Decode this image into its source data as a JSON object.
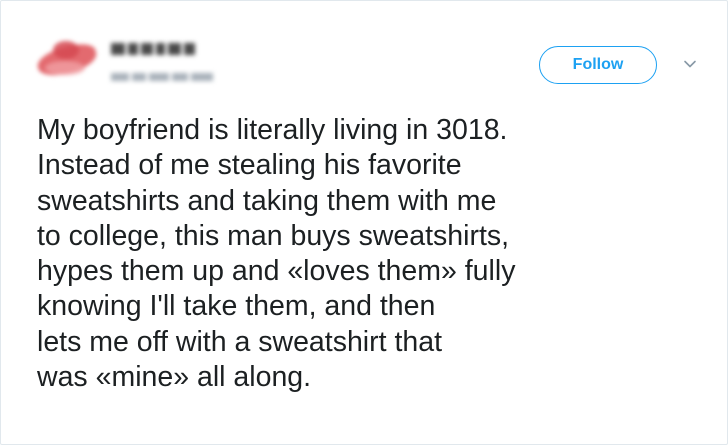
{
  "header": {
    "follow_label": "Follow",
    "accent_color": "#1da1f2",
    "avatar_icon": "blurred-avatar",
    "menu_icon": "chevron-down-icon"
  },
  "tweet": {
    "lines": [
      "My boyfriend is literally living in 3018.",
      "Instead of me stealing his favorite",
      "sweatshirts and taking them with me",
      "to college, this man buys sweatshirts,",
      "hypes them up and «loves them» fully",
      "knowing I'll take them, and then",
      "lets me off with a sweatshirt that",
      "was «mine» all along."
    ]
  }
}
